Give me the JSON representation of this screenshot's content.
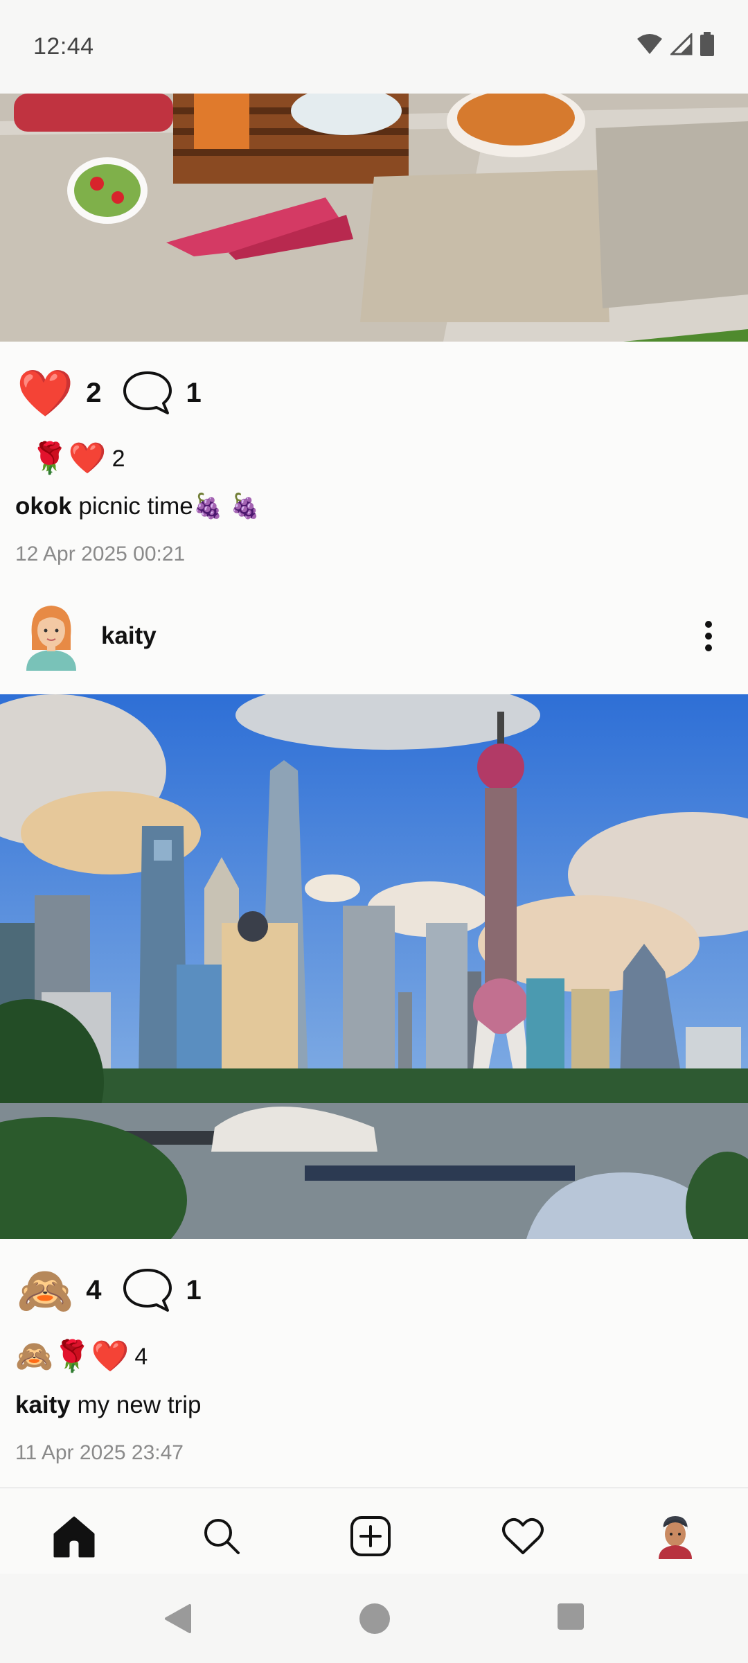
{
  "status_bar": {
    "time": "12:44"
  },
  "post1": {
    "likes_count": "2",
    "comments_count": "1",
    "reactions_emojis": "🌹❤️",
    "reactions_count": "2",
    "caption_user": "okok",
    "caption_text": " picnic time🍇 🍇",
    "timestamp": "12 Apr 2025 00:21",
    "like_emoji": "❤️"
  },
  "post2": {
    "username": "kaity",
    "avatar_emoji": "👩🏼‍🦰",
    "like_emoji": "🙈",
    "likes_count": "4",
    "comments_count": "1",
    "reactions_emojis": "🙈🌹❤️",
    "reactions_count": "4",
    "caption_user": "kaity",
    "caption_text": " my new trip",
    "timestamp": "11 Apr 2025 23:47"
  },
  "bottom_nav": {
    "items": [
      "home",
      "search",
      "create",
      "activity",
      "profile"
    ],
    "profile_emoji": "👨🏽"
  },
  "colors": {
    "accent": "#111111",
    "muted": "#8a8a8a",
    "background": "#fbfbfa"
  }
}
